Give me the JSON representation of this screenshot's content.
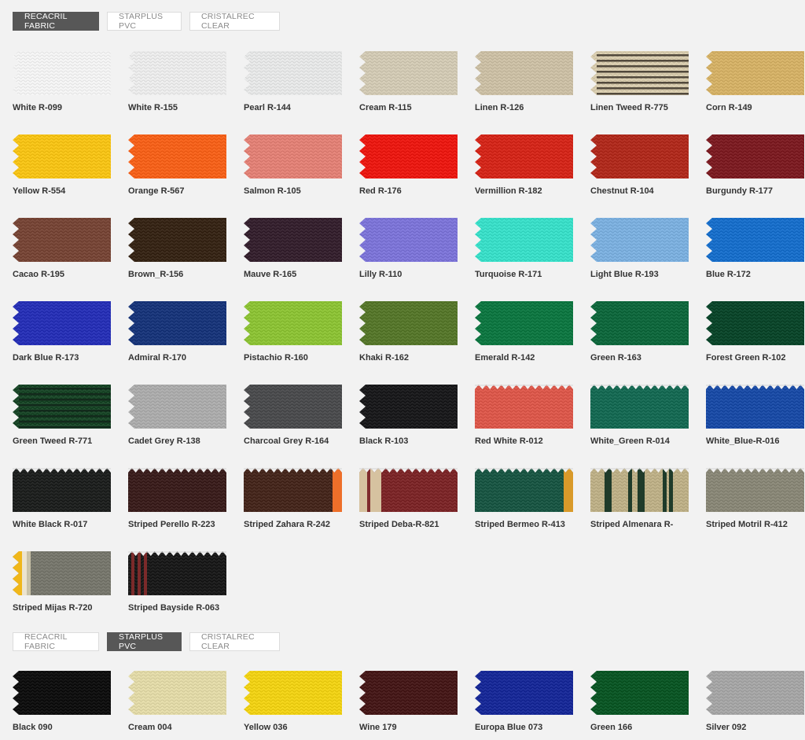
{
  "top_tabs": [
    {
      "label": "RECACRIL FABRIC",
      "active": true
    },
    {
      "label": "STARPLUS PVC",
      "active": false
    },
    {
      "label": "CRISTALREC CLEAR",
      "active": false
    }
  ],
  "bottom_tabs": [
    {
      "label": "RECACRIL FABRIC",
      "active": false
    },
    {
      "label": "STARPLUS PVC",
      "active": true
    },
    {
      "label": "CRISTALREC CLEAR",
      "active": false
    }
  ],
  "recacril_swatches": [
    {
      "name": "White R-099",
      "color": "#f4f4f4",
      "style": "plain"
    },
    {
      "name": "White R-155",
      "color": "#ececec",
      "style": "plain"
    },
    {
      "name": "Pearl R-144",
      "color": "#e7e8e8",
      "style": "plain"
    },
    {
      "name": "Cream R-115",
      "color": "#d3cbb6",
      "style": "plain"
    },
    {
      "name": "Linen R-126",
      "color": "#cdc1a7",
      "style": "plain"
    },
    {
      "name": "Linen Tweed R-775",
      "color": "#d9cdb0",
      "color2": "#3a3128",
      "style": "tweed"
    },
    {
      "name": "Corn R-149",
      "color": "#d6b36a",
      "style": "plain"
    },
    {
      "name": "Yellow R-554",
      "color": "#f8c51b",
      "style": "plain"
    },
    {
      "name": "Orange R-567",
      "color": "#f7651f",
      "style": "plain"
    },
    {
      "name": "Salmon R-105",
      "color": "#e38479",
      "style": "plain"
    },
    {
      "name": "Red R-176",
      "color": "#ec1e17",
      "style": "plain"
    },
    {
      "name": "Vermillion R-182",
      "color": "#d52b1f",
      "style": "plain"
    },
    {
      "name": "Chestnut R-104",
      "color": "#b22f22",
      "style": "plain"
    },
    {
      "name": "Burgundy R-177",
      "color": "#7f2127",
      "style": "plain"
    },
    {
      "name": "Cacao R-195",
      "color": "#7a4a3b",
      "style": "plain"
    },
    {
      "name": "Brown_R-156",
      "color": "#3b2a1b",
      "style": "plain"
    },
    {
      "name": "Mauve R-165",
      "color": "#3a2633",
      "style": "plain"
    },
    {
      "name": "Lilly R-110",
      "color": "#8078d9",
      "style": "plain"
    },
    {
      "name": "Turquoise R-171",
      "color": "#3ee0ca",
      "style": "plain"
    },
    {
      "name": "Light Blue R-193",
      "color": "#7fb2e0",
      "style": "plain"
    },
    {
      "name": "Blue R-172",
      "color": "#1d72cc",
      "style": "plain"
    },
    {
      "name": "Dark Blue R-173",
      "color": "#2c35b8",
      "style": "plain"
    },
    {
      "name": "Admiral R-170",
      "color": "#1e3a7d",
      "style": "plain"
    },
    {
      "name": "Pistachio R-160",
      "color": "#8fc43a",
      "style": "plain"
    },
    {
      "name": "Khaki R-162",
      "color": "#5a7a30",
      "style": "plain"
    },
    {
      "name": "Emerald R-142",
      "color": "#137a46",
      "style": "plain"
    },
    {
      "name": "Green R-163",
      "color": "#146b41",
      "style": "plain"
    },
    {
      "name": "Forest Green R-102",
      "color": "#0f4a2f",
      "style": "plain"
    },
    {
      "name": "Green Tweed R-771",
      "color": "#1e4a2c",
      "color2": "#12251a",
      "style": "tweed"
    },
    {
      "name": "Cadet Grey R-138",
      "color": "#aeaeae",
      "style": "plain"
    },
    {
      "name": "Charcoal Grey R-164",
      "color": "#4f5052",
      "style": "plain"
    },
    {
      "name": "Black R-103",
      "color": "#1f1f21",
      "style": "plain"
    },
    {
      "name": "Red White R-012",
      "color": "#dd5c4f",
      "style": "valance"
    },
    {
      "name": "White_Green R-014",
      "color": "#1b6d57",
      "style": "valance"
    },
    {
      "name": "White_Blue-R-016",
      "color": "#1f4fa8",
      "style": "valance"
    },
    {
      "name": "White Black R-017",
      "color": "#232524",
      "style": "valance"
    },
    {
      "name": "Striped Perello R-223",
      "color": "#3f2322",
      "style": "valance"
    },
    {
      "name": "Striped Zahara R-242",
      "color": "#4a2c22",
      "color2": "#ee6f2a",
      "style": "valance-edge"
    },
    {
      "name": "Striped Deba-R-821",
      "color": "#7f2b2d",
      "color2": "#d6c2a0",
      "style": "valance-left"
    },
    {
      "name": "Striped Bermeo R-413",
      "color": "#1f5a48",
      "color2": "#d99a2a",
      "style": "valance-edge"
    },
    {
      "name": "Striped Almenara R-",
      "color": "#bfb28a",
      "color2": "#1f3b2a",
      "style": "valance-stripes"
    },
    {
      "name": "Striped Motril R-412",
      "color": "#8c8a7a",
      "style": "valance"
    },
    {
      "name": "Striped Mijas R-720",
      "color": "#7a7a70",
      "color2": "#f0b71a",
      "style": "stripes-left"
    },
    {
      "name": "Striped Bayside R-063",
      "color": "#1f1f1f",
      "color2": "#7b2a2a",
      "style": "valance-stripes2"
    }
  ],
  "starplus_swatches": [
    {
      "name": "Black 090",
      "color": "#141414",
      "style": "plain"
    },
    {
      "name": "Cream 004",
      "color": "#e3dbaa",
      "style": "plain"
    },
    {
      "name": "Yellow 036",
      "color": "#f2d31a",
      "style": "plain"
    },
    {
      "name": "Wine 179",
      "color": "#4a1e1e",
      "style": "plain"
    },
    {
      "name": "Europa Blue 073",
      "color": "#1d2e9a",
      "style": "plain"
    },
    {
      "name": "Green 166",
      "color": "#0f5a2a",
      "style": "plain"
    },
    {
      "name": "Silver 092",
      "color": "#a8a8a8",
      "style": "plain"
    }
  ]
}
